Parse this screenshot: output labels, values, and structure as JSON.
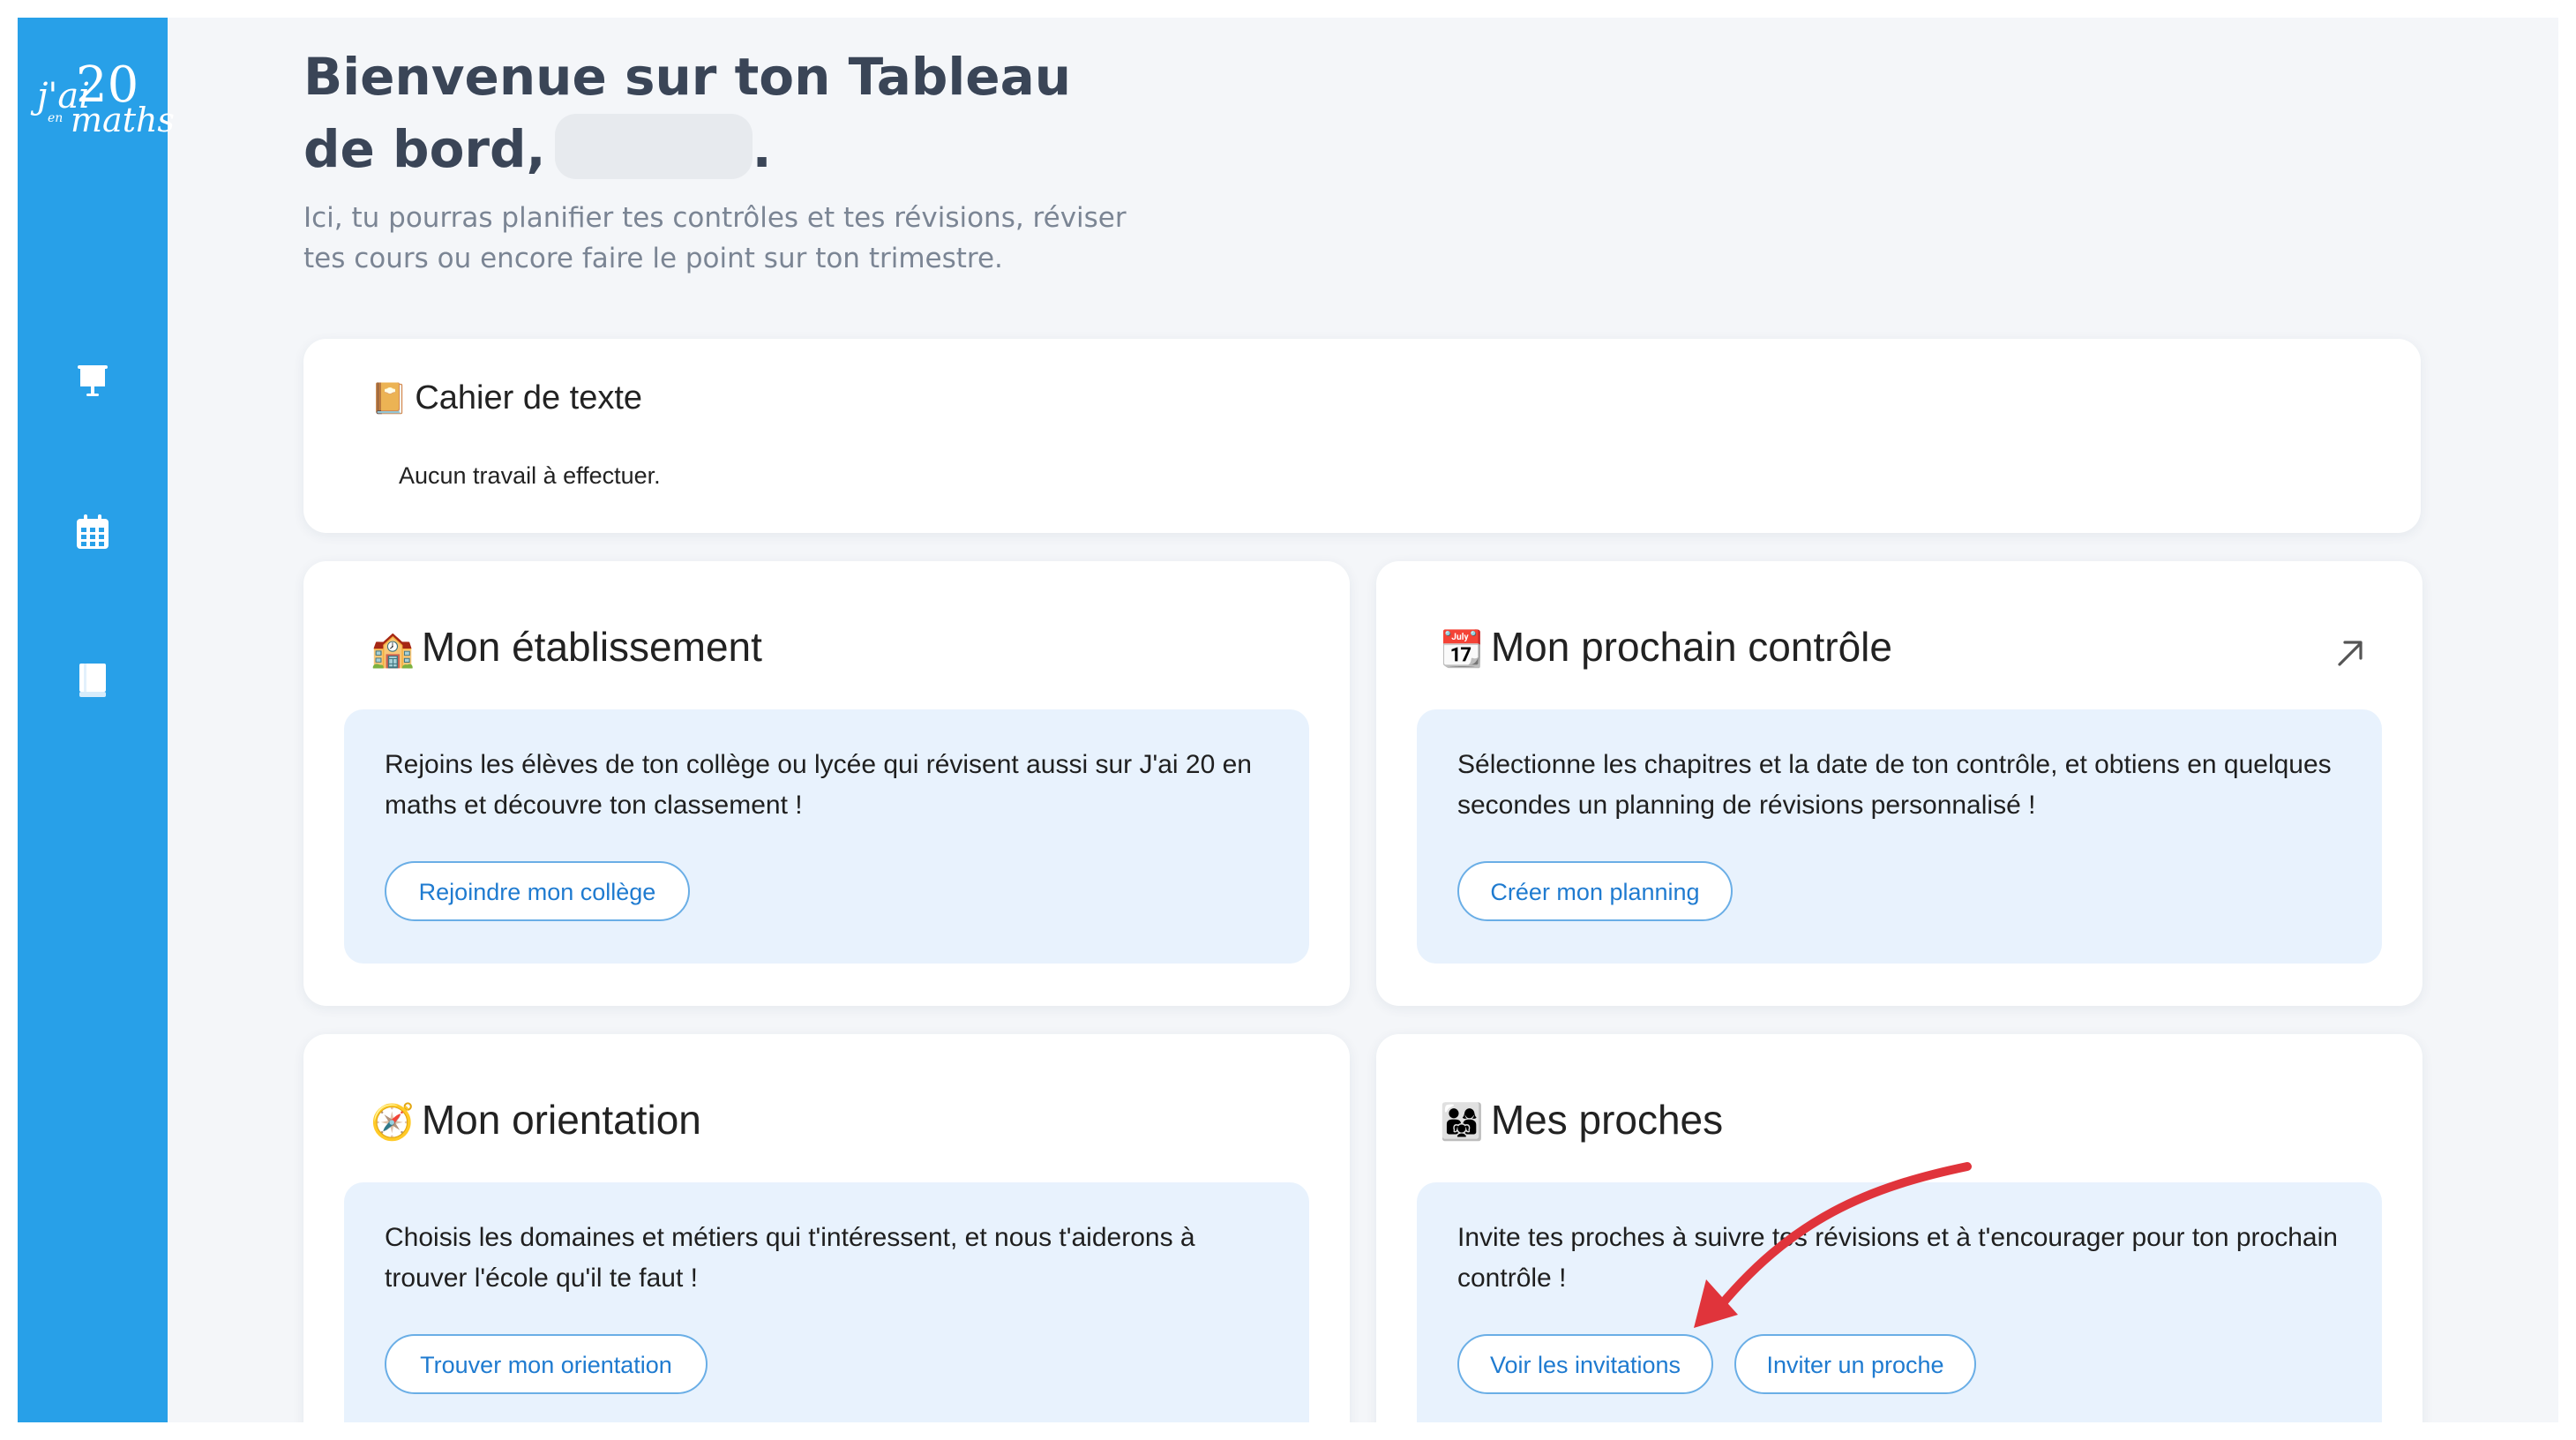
{
  "logo": {
    "line1": "j'ai",
    "line2": "20",
    "line3": "en",
    "line4": "maths"
  },
  "sidebar": {
    "items": [
      {
        "icon": "presentation-board-icon"
      },
      {
        "icon": "calendar-icon"
      },
      {
        "icon": "book-icon"
      }
    ]
  },
  "header": {
    "title_line1": "Bienvenue sur ton Tableau",
    "title_line2": "de bord,",
    "title_end": ".",
    "subtitle_line1": "Ici, tu pourras planifier tes contrôles et tes révisions, réviser",
    "subtitle_line2": "tes cours ou encore faire le point sur ton trimestre."
  },
  "cahier": {
    "icon": "📔",
    "title": "Cahier de texte",
    "empty": "Aucun travail à effectuer."
  },
  "etablissement": {
    "icon": "🏫",
    "title": "Mon établissement",
    "text": "Rejoins les élèves de ton collège ou lycée qui révisent aussi sur J'ai 20 en maths et découvre ton classement !",
    "button": "Rejoindre mon collège"
  },
  "controle": {
    "icon": "📆",
    "title": "Mon prochain contrôle",
    "text": "Sélectionne les chapitres et la date de ton contrôle, et obtiens en quelques secondes un planning de révisions personnalisé !",
    "button": "Créer mon planning"
  },
  "orientation": {
    "icon": "🧭",
    "title": "Mon orientation",
    "text": "Choisis les domaines et métiers qui t'intéressent, et nous t'aiderons à trouver l'école qu'il te faut !",
    "button": "Trouver mon orientation"
  },
  "proches": {
    "icon": "👨‍👩‍👧",
    "title": "Mes proches",
    "text": "Invite tes proches à suivre tes révisions et à t'encourager pour ton prochain contrôle !",
    "button1": "Voir les invitations",
    "button2": "Inviter un proche"
  },
  "colors": {
    "sidebar": "#28a0e8",
    "accent": "#1f7bd0",
    "annotation_arrow": "#e0343b"
  }
}
